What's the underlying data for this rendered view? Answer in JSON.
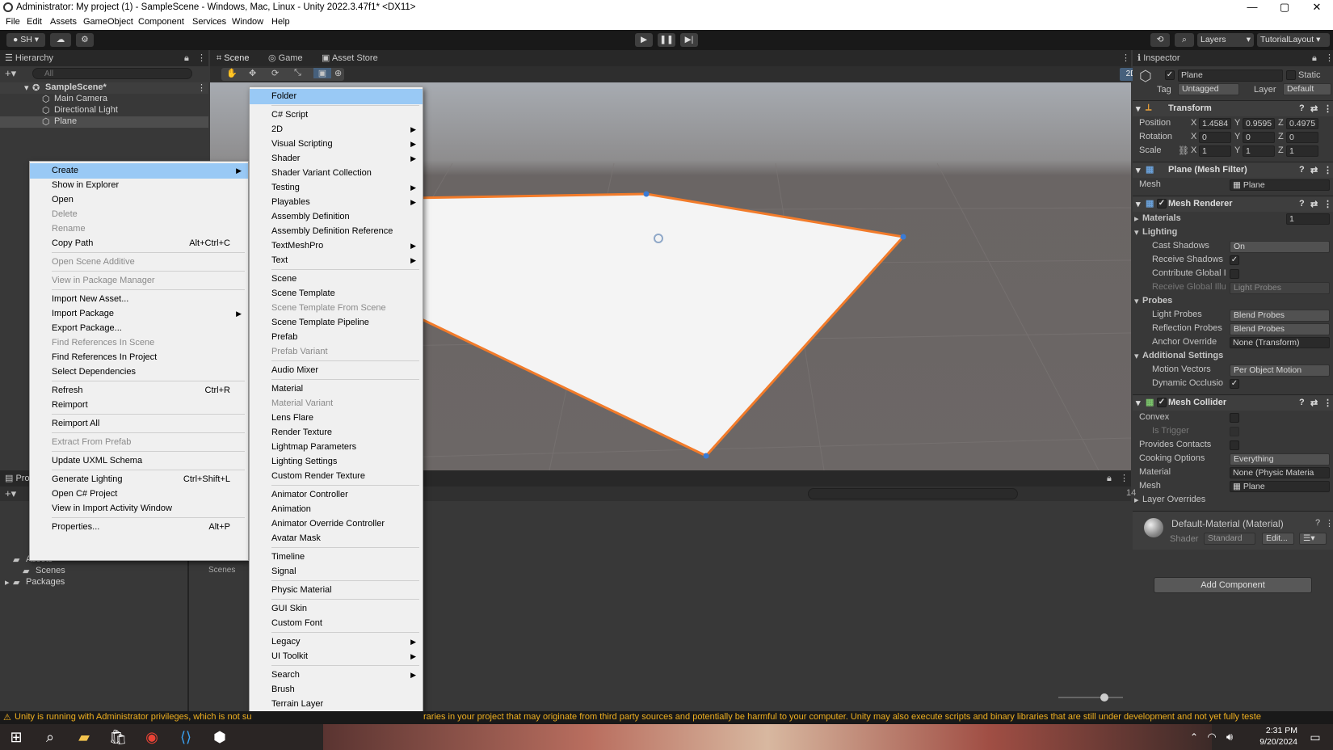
{
  "window": {
    "title": "Administrator: My project (1) - SampleScene - Windows, Mac, Linux - Unity 2022.3.47f1* <DX11>",
    "controls": [
      "—",
      "▢",
      "✕"
    ]
  },
  "menubar": [
    "File",
    "Edit",
    "Assets",
    "GameObject",
    "Component",
    "Services",
    "Window",
    "Help"
  ],
  "toolbar": {
    "account": "SH",
    "layers": "Layers",
    "layout": "TutorialLayout"
  },
  "hierarchy": {
    "tab": "Hierarchy",
    "search_placeholder": "All",
    "scene": "SampleScene*",
    "objects": [
      "Main Camera",
      "Directional Light",
      "Plane"
    ]
  },
  "center_tabs": [
    "Scene",
    "Game",
    "Asset Store"
  ],
  "scene_toolbar": {
    "mode_2d": "2D"
  },
  "inspector": {
    "tab": "Inspector",
    "object_name": "Plane",
    "static_label": "Static",
    "tag_label": "Tag",
    "tag_value": "Untagged",
    "layer_label": "Layer",
    "layer_value": "Default",
    "transform": {
      "title": "Transform",
      "position_label": "Position",
      "rotation_label": "Rotation",
      "scale_label": "Scale",
      "position": {
        "x": "1.4584",
        "y": "0.9595",
        "z": "0.4975"
      },
      "rotation": {
        "x": "0",
        "y": "0",
        "z": "0"
      },
      "scale": {
        "x": "1",
        "y": "1",
        "z": "1"
      }
    },
    "mesh_filter": {
      "title": "Plane (Mesh Filter)",
      "mesh_label": "Mesh",
      "mesh_value": "Plane"
    },
    "mesh_renderer": {
      "title": "Mesh Renderer",
      "materials_label": "Materials",
      "materials_count": "1",
      "lighting_label": "Lighting",
      "cast_shadows_label": "Cast Shadows",
      "cast_shadows_value": "On",
      "receive_shadows_label": "Receive Shadows",
      "contribute_gi_label": "Contribute Global I",
      "receive_gi_label": "Receive Global Illu",
      "receive_gi_value": "Light Probes",
      "probes_label": "Probes",
      "light_probes_label": "Light Probes",
      "light_probes_value": "Blend Probes",
      "reflection_probes_label": "Reflection Probes",
      "reflection_probes_value": "Blend Probes",
      "anchor_override_label": "Anchor Override",
      "anchor_override_value": "None (Transform)",
      "additional_label": "Additional Settings",
      "motion_vectors_label": "Motion Vectors",
      "motion_vectors_value": "Per Object Motion",
      "dynamic_occlusion_label": "Dynamic Occlusio"
    },
    "mesh_collider": {
      "title": "Mesh Collider",
      "convex_label": "Convex",
      "is_trigger_label": "Is Trigger",
      "provides_contacts_label": "Provides Contacts",
      "cooking_options_label": "Cooking Options",
      "cooking_options_value": "Everything",
      "material_label": "Material",
      "material_value": "None (Physic Materia",
      "mesh_label": "Mesh",
      "mesh_value": "Plane",
      "layer_overrides_label": "Layer Overrides"
    },
    "material": {
      "title": "Default-Material (Material)",
      "shader_label": "Shader",
      "shader_value": "Standard",
      "edit_button": "Edit..."
    },
    "add_component": "Add Component"
  },
  "project": {
    "tab_partial": "Pro",
    "folders": [
      "Assets",
      "Scenes",
      "Packages"
    ],
    "grid_item": "Scenes",
    "count": "14"
  },
  "context_menu": [
    {
      "label": "Create",
      "highlighted": true,
      "submenu": true
    },
    {
      "label": "Show in Explorer"
    },
    {
      "label": "Open"
    },
    {
      "label": "Delete",
      "disabled": true
    },
    {
      "label": "Rename",
      "disabled": true
    },
    {
      "label": "Copy Path",
      "shortcut": "Alt+Ctrl+C"
    },
    {
      "separator": true
    },
    {
      "label": "Open Scene Additive",
      "disabled": true
    },
    {
      "separator": true
    },
    {
      "label": "View in Package Manager",
      "disabled": true
    },
    {
      "separator": true
    },
    {
      "label": "Import New Asset..."
    },
    {
      "label": "Import Package",
      "submenu": true
    },
    {
      "label": "Export Package..."
    },
    {
      "label": "Find References In Scene",
      "disabled": true
    },
    {
      "label": "Find References In Project"
    },
    {
      "label": "Select Dependencies"
    },
    {
      "separator": true
    },
    {
      "label": "Refresh",
      "shortcut": "Ctrl+R"
    },
    {
      "label": "Reimport"
    },
    {
      "separator": true
    },
    {
      "label": "Reimport All"
    },
    {
      "separator": true
    },
    {
      "label": "Extract From Prefab",
      "disabled": true
    },
    {
      "separator": true
    },
    {
      "label": "Update UXML Schema"
    },
    {
      "separator": true
    },
    {
      "label": "Generate Lighting",
      "shortcut": "Ctrl+Shift+L"
    },
    {
      "label": "Open C# Project"
    },
    {
      "label": "View in Import Activity Window"
    },
    {
      "separator": true
    },
    {
      "label": "Properties...",
      "shortcut": "Alt+P"
    }
  ],
  "create_submenu": [
    {
      "label": "Folder",
      "highlighted": true
    },
    {
      "separator": true
    },
    {
      "label": "C# Script"
    },
    {
      "label": "2D",
      "submenu": true
    },
    {
      "label": "Visual Scripting",
      "submenu": true
    },
    {
      "label": "Shader",
      "submenu": true
    },
    {
      "label": "Shader Variant Collection"
    },
    {
      "label": "Testing",
      "submenu": true
    },
    {
      "label": "Playables",
      "submenu": true
    },
    {
      "label": "Assembly Definition"
    },
    {
      "label": "Assembly Definition Reference"
    },
    {
      "label": "TextMeshPro",
      "submenu": true
    },
    {
      "label": "Text",
      "submenu": true
    },
    {
      "separator": true
    },
    {
      "label": "Scene"
    },
    {
      "label": "Scene Template"
    },
    {
      "label": "Scene Template From Scene",
      "disabled": true
    },
    {
      "label": "Scene Template Pipeline"
    },
    {
      "label": "Prefab"
    },
    {
      "label": "Prefab Variant",
      "disabled": true
    },
    {
      "separator": true
    },
    {
      "label": "Audio Mixer"
    },
    {
      "separator": true
    },
    {
      "label": "Material"
    },
    {
      "label": "Material Variant",
      "disabled": true
    },
    {
      "label": "Lens Flare"
    },
    {
      "label": "Render Texture"
    },
    {
      "label": "Lightmap Parameters"
    },
    {
      "label": "Lighting Settings"
    },
    {
      "label": "Custom Render Texture"
    },
    {
      "separator": true
    },
    {
      "label": "Animator Controller"
    },
    {
      "label": "Animation"
    },
    {
      "label": "Animator Override Controller"
    },
    {
      "label": "Avatar Mask"
    },
    {
      "separator": true
    },
    {
      "label": "Timeline"
    },
    {
      "label": "Signal"
    },
    {
      "separator": true
    },
    {
      "label": "Physic Material"
    },
    {
      "separator": true
    },
    {
      "label": "GUI Skin"
    },
    {
      "label": "Custom Font"
    },
    {
      "separator": true
    },
    {
      "label": "Legacy",
      "submenu": true
    },
    {
      "label": "UI Toolkit",
      "submenu": true
    },
    {
      "separator": true
    },
    {
      "label": "Search",
      "submenu": true
    },
    {
      "label": "Brush"
    },
    {
      "label": "Terrain Layer"
    }
  ],
  "status": {
    "left": "Unity is running with Administrator privileges, which is not su",
    "right": "raries in your project that may originate from third party sources and potentially be harmful to your computer. Unity may also execute scripts and binary libraries that are still under development and not yet fully teste"
  },
  "taskbar": {
    "time": "2:31 PM",
    "date": "9/20/2024"
  },
  "colors": {
    "accent": "#99c9f5",
    "selection_outline": "#f27b2a",
    "warning": "#f0b020"
  }
}
